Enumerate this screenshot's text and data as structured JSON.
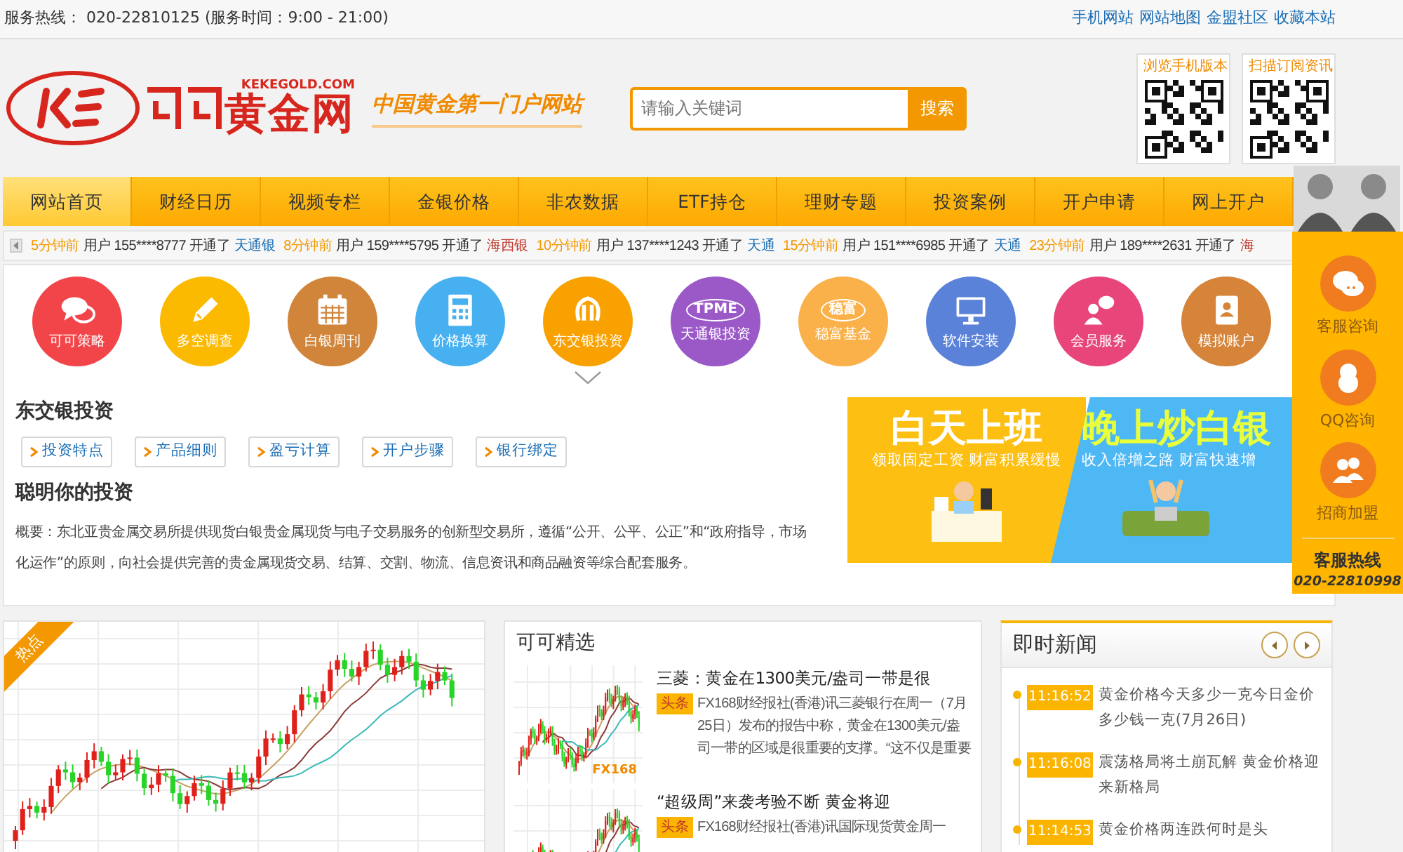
{
  "top_bar": {
    "service_line": "服务热线： 020-22810125 (服务时间：9:00 - 21:00)",
    "links": [
      "手机网站",
      "网站地图",
      "金盟社区",
      "收藏本站"
    ]
  },
  "header": {
    "logo_domain": "KEKEGOLD.COM",
    "logo_name": "黄金网",
    "slogan": "中国黄金第一门户网站",
    "search": {
      "placeholder": "请输入关键词",
      "button": "搜索"
    },
    "qr_codes": [
      {
        "label": "浏览手机版本"
      },
      {
        "label": "扫描订阅资讯"
      }
    ]
  },
  "nav": [
    {
      "label": "网站首页",
      "selected": true
    },
    {
      "label": "财经日历",
      "selected": false
    },
    {
      "label": "视频专栏",
      "selected": false
    },
    {
      "label": "金银价格",
      "selected": false
    },
    {
      "label": "非农数据",
      "selected": false
    },
    {
      "label": "ETF持仓",
      "selected": false
    },
    {
      "label": "理财专题",
      "selected": false
    },
    {
      "label": "投资案例",
      "selected": false
    },
    {
      "label": "开户申请",
      "selected": false
    },
    {
      "label": "网上开户",
      "selected": false
    }
  ],
  "ticker": [
    {
      "time": "5分钟前",
      "message": "用户 155****8777 开通了",
      "product": "天通银",
      "color": "#1a6eb5"
    },
    {
      "time": "8分钟前",
      "message": "用户 159****5795 开通了",
      "product": "海西银",
      "color": "#c0392b"
    },
    {
      "time": "10分钟前",
      "message": "用户 137****1243 开通了",
      "product": "天通",
      "color": "#1a6eb5"
    },
    {
      "time": "15分钟前",
      "message": "用户 151****6985 开通了",
      "product": "天通",
      "color": "#1a6eb5"
    },
    {
      "time": "23分钟前",
      "message": "用户 189****2631 开通了",
      "product": "海",
      "color": "#c0392b"
    }
  ],
  "services": [
    {
      "label": "可可策略",
      "color": "#f2454a",
      "selected": false
    },
    {
      "label": "多空调查",
      "color": "#fbb900",
      "selected": false
    },
    {
      "label": "白银周刊",
      "color": "#d0853b",
      "selected": false
    },
    {
      "label": "价格换算",
      "color": "#46b0f0",
      "selected": false
    },
    {
      "label": "东交银投资",
      "color": "#f8a100",
      "selected": true
    },
    {
      "label": "天通银投资",
      "color": "#9b59c8",
      "selected": false,
      "icon_text": "TPME"
    },
    {
      "label": "稳富基金",
      "color": "#fbb14a",
      "selected": false,
      "icon_text": "稳富"
    },
    {
      "label": "软件安装",
      "color": "#5a82d8",
      "selected": false
    },
    {
      "label": "会员服务",
      "color": "#e8457a",
      "selected": false
    },
    {
      "label": "模拟账户",
      "color": "#d5843a",
      "selected": false
    }
  ],
  "detail": {
    "title": "东交银投资",
    "tabs": [
      "投资特点",
      "产品细则",
      "盈亏计算",
      "开户步骤",
      "银行绑定"
    ],
    "heading": "聪明你的投资",
    "summary": "概要：东北亚贵金属交易所提供现货白银贵金属现货与电子交易服务的创新型交易所，遵循“公开、公平、公正”和“政府指导，市场化运作”的原则，向社会提供完善的贵金属现货交易、结算、交割、物流、信息资讯和商品融资等综合配套服务。"
  },
  "banner": {
    "left_title": "白天上班",
    "left_subtitle": "领取固定工资  财富积累缓慢",
    "right_title": "晚上炒白银",
    "right_subtitle": "收入倍增之路 财富快速增"
  },
  "side_panel": {
    "items": [
      {
        "label": "客服咨询"
      },
      {
        "label": "QQ咨询"
      },
      {
        "label": "招商加盟"
      }
    ],
    "hotline_label": "客服热线",
    "hotline": "020-22810998"
  },
  "hot_chart": {
    "tag": "热点"
  },
  "featured": {
    "title": "可可精选",
    "items": [
      {
        "thumb_label": "FX168",
        "title": "三菱：黄金在1300美元/盎司一带是很",
        "tag": "头条",
        "summary": "FX168财经报社(香港)讯三菱银行在周一（7月25日）发布的报告中称，黄金在1300美元/盎司一带的区域是很重要的支撑。“这不仅是重要"
      },
      {
        "title": "“超级周”来袭考验不断 黄金将迎",
        "tag": "头条",
        "summary": "FX168财经报社(香港)讯国际现货黄金周一"
      }
    ]
  },
  "news": {
    "title": "即时新闻",
    "items": [
      {
        "time": "11:16:52",
        "text": "黄金价格今天多少一克今日金价多少钱一克(7月26日)"
      },
      {
        "time": "11:16:08",
        "text": "震荡格局将土崩瓦解 黄金价格迎来新格局"
      },
      {
        "time": "11:14:53",
        "text": "黄金价格两连跌何时是头"
      }
    ]
  }
}
